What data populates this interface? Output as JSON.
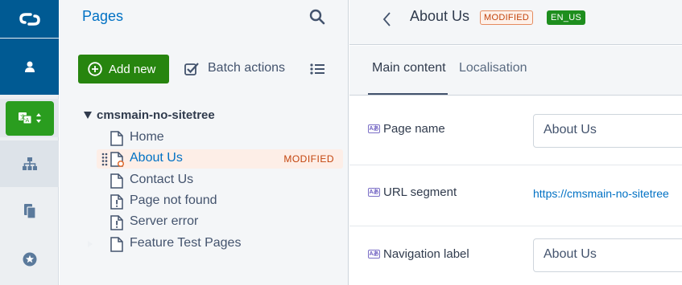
{
  "rail": {
    "items": [
      "logo",
      "user",
      "locale",
      "sitetree",
      "files",
      "favourites"
    ]
  },
  "pages_panel": {
    "title": "Pages",
    "add_new_label": "Add new",
    "batch_actions_label": "Batch actions",
    "tree": {
      "root": "cmsmain-no-sitetree",
      "items": [
        {
          "label": "Home",
          "status": ""
        },
        {
          "label": "About Us",
          "status": "MODIFIED"
        },
        {
          "label": "Contact Us",
          "status": ""
        },
        {
          "label": "Page not found",
          "status": ""
        },
        {
          "label": "Server error",
          "status": ""
        },
        {
          "label": "Feature Test Pages",
          "status": ""
        }
      ]
    }
  },
  "editor": {
    "title": "About Us",
    "badges": {
      "status": "MODIFIED",
      "locale": "EN_US"
    },
    "tabs": [
      {
        "label": "Main content",
        "active": true
      },
      {
        "label": "Localisation",
        "active": false
      }
    ],
    "fields": {
      "page_name": {
        "label": "Page name",
        "value": "About Us"
      },
      "url_segment": {
        "label": "URL segment",
        "value": "https://cmsmain-no-sitetree"
      },
      "navigation_label": {
        "label": "Navigation label",
        "value": "About Us"
      }
    },
    "lang_icon_text": "Aあ"
  },
  "colors": {
    "brand_blue": "#005a93",
    "link_blue": "#0071c4",
    "success_green": "#27850f",
    "modified_orange": "#c3440c"
  }
}
